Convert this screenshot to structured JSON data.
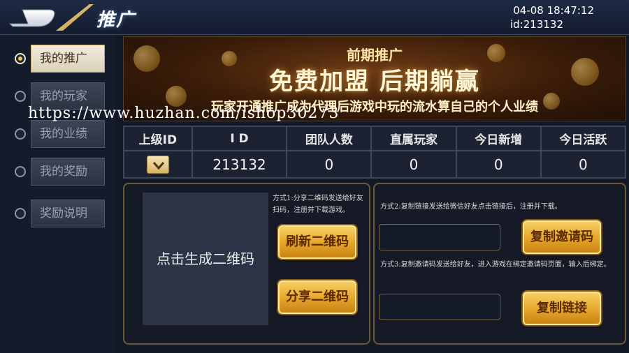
{
  "header": {
    "title": "推广",
    "date_time": "04-08  18:47:12",
    "user_id": "id:213132",
    "back_icon": "back-arrow-icon"
  },
  "sidebar": {
    "items": [
      {
        "label": "我的推广",
        "active": true
      },
      {
        "label": "我的玩家",
        "active": false
      },
      {
        "label": "我的业绩",
        "active": false
      },
      {
        "label": "我的奖励",
        "active": false
      },
      {
        "label": "奖励说明",
        "active": false
      }
    ]
  },
  "banner": {
    "subtitle": "前期推广",
    "headline": "免费加盟 后期躺赢",
    "description": "玩家开通推广成为代理后游戏中玩的流水算自己的个人业绩"
  },
  "watermark": "https://www.huzhan.com/ishop30273",
  "stats": {
    "headers": [
      "上级ID",
      "I D",
      "团队人数",
      "直属玩家",
      "今日新增",
      "今日活跃"
    ],
    "values": [
      "",
      "213132",
      "0",
      "0",
      "0",
      "0"
    ]
  },
  "qr_panel": {
    "qr_placeholder": "点击生成二维码",
    "method1_note": "方式1:分享二维码发送给好友扫码，注册并下载游戏。",
    "refresh_label": "刷新二维码",
    "share_label": "分享二维码"
  },
  "link_panel": {
    "method2_note": "方式2:复制链接发送给微信好友点击链接后，注册并下载。",
    "copy_invite_label": "复制邀请码",
    "method3_note": "方式3:复制邀请码发送给好友，进入游戏在绑定邀请码页面，输入后绑定。",
    "copy_link_label": "复制链接",
    "invite_input_value": "",
    "link_input_value": ""
  },
  "colors": {
    "accent_gold": "#e7a82c",
    "background": "#121826",
    "active_tab": "#f2eddf"
  }
}
